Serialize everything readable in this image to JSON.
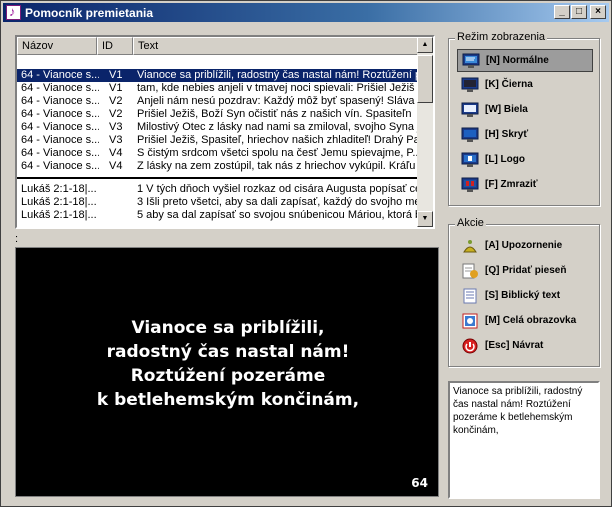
{
  "window": {
    "title": "Pomocník premietania"
  },
  "colors": {
    "title_bar": "#0a246a",
    "selection": "#0a246a",
    "preview_bg": "#000000"
  },
  "list": {
    "columns": [
      "Názov",
      "ID",
      "Text"
    ],
    "song_rows": [
      {
        "name": "64 - Vianoce s...",
        "id": "V1",
        "text": "Vianoce sa priblížili, radostný čas nastal nám! Roztúžení p"
      },
      {
        "name": "64 - Vianoce s...",
        "id": "V1",
        "text": "tam, kde nebies anjeli v tmavej noci spievali: Prišiel Ježiš"
      },
      {
        "name": "64 - Vianoce s...",
        "id": "V2",
        "text": "Anjeli nám nesú pozdrav: Každý môž byť spasený! Sláva"
      },
      {
        "name": "64 - Vianoce s...",
        "id": "V2",
        "text": "Prišiel Ježiš, Boží Syn očistiť nás z našich vín. Spasiteľn"
      },
      {
        "name": "64 - Vianoce s...",
        "id": "V3",
        "text": "Milostivý Otec z lásky nad nami sa zmiloval, svojho Syna j"
      },
      {
        "name": "64 - Vianoce s...",
        "id": "V3",
        "text": "Prišiel Ježiš, Spasiteľ, hriechov našich zhladiteľ! Drahý Pa"
      },
      {
        "name": "64 - Vianoce s...",
        "id": "V4",
        "text": "S čistým srdcom všetci spolu na česť Jemu spievajme, P..."
      },
      {
        "name": "64 - Vianoce s...",
        "id": "V4",
        "text": "Z lásky na zem zostúpil, tak nás z hriechov vykúpil. Kráľu n"
      }
    ],
    "bible_rows": [
      {
        "name": "Lukáš 2:1-18|...",
        "id": "",
        "text": "1 V tých dňoch vyšiel rozkaz od cisára Augusta popísať cel"
      },
      {
        "name": "Lukáš 2:1-18|...",
        "id": "",
        "text": "3 Išli preto všetci, aby sa dali zapísať, každý do svojho me"
      },
      {
        "name": "Lukáš 2:1-18|...",
        "id": "",
        "text": "5 aby sa dal zapísať so svojou snúbenicou Máriou, ktorá b"
      }
    ]
  },
  "status_colon": ":",
  "preview": {
    "lines": [
      "Vianoce sa priblížili,",
      "radostný čas nastal nám!",
      "Roztúžení pozeráme",
      "k betlehemským končinám,"
    ],
    "number": "64"
  },
  "display_mode": {
    "title": "Režim zobrazenia",
    "items": [
      {
        "label": "[N] Normálne",
        "icon": "monitor-normal-icon"
      },
      {
        "label": "[K] Čierna",
        "icon": "monitor-black-icon"
      },
      {
        "label": "[W] Biela",
        "icon": "monitor-white-icon"
      },
      {
        "label": "[H] Skryť",
        "icon": "monitor-hide-icon"
      },
      {
        "label": "[L] Logo",
        "icon": "monitor-logo-icon"
      },
      {
        "label": "[F] Zmraziť",
        "icon": "monitor-freeze-icon"
      }
    ]
  },
  "actions": {
    "title": "Akcie",
    "items": [
      {
        "label": "[A] Upozornenie",
        "icon": "alert-icon"
      },
      {
        "label": "[Q] Pridať pieseň",
        "icon": "add-song-icon"
      },
      {
        "label": "[S] Biblický text",
        "icon": "bible-text-icon"
      },
      {
        "label": "[M] Celá obrazovka",
        "icon": "fullscreen-icon"
      },
      {
        "label": "[Esc] Návrat",
        "icon": "return-icon"
      }
    ]
  },
  "notes_text": "Vianoce sa priblížili, radostný čas nastal nám! Roztúžení pozeráme k betlehemským končinám,"
}
